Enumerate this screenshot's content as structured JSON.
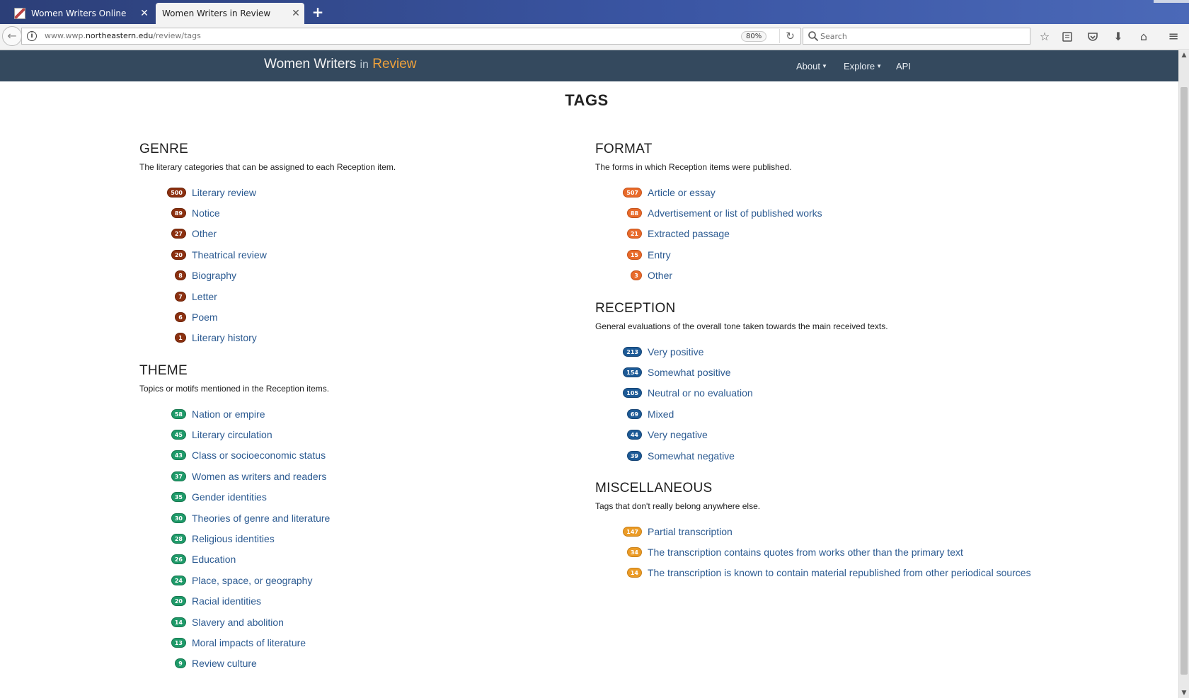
{
  "browser": {
    "tabs": [
      {
        "label": "Women Writers Online",
        "active": false
      },
      {
        "label": "Women Writers in Review",
        "active": true
      }
    ],
    "url": {
      "prefix": "www.wwp.",
      "host": "northeastern.edu",
      "path": "/review/tags"
    },
    "zoom": "80%",
    "search_placeholder": "Search"
  },
  "site": {
    "brand_main": "Women Writers",
    "brand_in": "in",
    "brand_accent": "Review",
    "nav": [
      {
        "label": "About",
        "dropdown": true
      },
      {
        "label": "Explore",
        "dropdown": true
      },
      {
        "label": "API",
        "dropdown": false
      }
    ]
  },
  "page": {
    "title": "TAGS",
    "sections": {
      "genre": {
        "heading": "GENRE",
        "description": "The literary categories that can be assigned to each Reception item.",
        "tags": [
          {
            "count": "500",
            "label": "Literary review"
          },
          {
            "count": "89",
            "label": "Notice"
          },
          {
            "count": "27",
            "label": "Other"
          },
          {
            "count": "20",
            "label": "Theatrical review"
          },
          {
            "count": "8",
            "label": "Biography"
          },
          {
            "count": "7",
            "label": "Letter"
          },
          {
            "count": "6",
            "label": "Poem"
          },
          {
            "count": "1",
            "label": "Literary history"
          }
        ]
      },
      "theme": {
        "heading": "THEME",
        "description": "Topics or motifs mentioned in the Reception items.",
        "tags": [
          {
            "count": "58",
            "label": "Nation or empire"
          },
          {
            "count": "45",
            "label": "Literary circulation"
          },
          {
            "count": "43",
            "label": "Class or socioeconomic status"
          },
          {
            "count": "37",
            "label": "Women as writers and readers"
          },
          {
            "count": "35",
            "label": "Gender identities"
          },
          {
            "count": "30",
            "label": "Theories of genre and literature"
          },
          {
            "count": "28",
            "label": "Religious identities"
          },
          {
            "count": "26",
            "label": "Education"
          },
          {
            "count": "24",
            "label": "Place, space, or geography"
          },
          {
            "count": "20",
            "label": "Racial identities"
          },
          {
            "count": "14",
            "label": "Slavery and abolition"
          },
          {
            "count": "13",
            "label": "Moral impacts of literature"
          },
          {
            "count": "9",
            "label": "Review culture"
          }
        ]
      },
      "format": {
        "heading": "FORMAT",
        "description": "The forms in which Reception items were published.",
        "tags": [
          {
            "count": "507",
            "label": "Article or essay"
          },
          {
            "count": "88",
            "label": "Advertisement or list of published works"
          },
          {
            "count": "21",
            "label": "Extracted passage"
          },
          {
            "count": "15",
            "label": "Entry"
          },
          {
            "count": "3",
            "label": "Other"
          }
        ]
      },
      "reception": {
        "heading": "RECEPTION",
        "description": "General evaluations of the overall tone taken towards the main received texts.",
        "tags": [
          {
            "count": "213",
            "label": "Very positive"
          },
          {
            "count": "154",
            "label": "Somewhat positive"
          },
          {
            "count": "105",
            "label": "Neutral or no evaluation"
          },
          {
            "count": "69",
            "label": "Mixed"
          },
          {
            "count": "44",
            "label": "Very negative"
          },
          {
            "count": "39",
            "label": "Somewhat negative"
          }
        ]
      },
      "misc": {
        "heading": "MISCELLANEOUS",
        "description": "Tags that don't really belong anywhere else.",
        "tags": [
          {
            "count": "147",
            "label": "Partial transcription"
          },
          {
            "count": "34",
            "label": "The transcription contains quotes from works other than the primary text"
          },
          {
            "count": "14",
            "label": "The transcription is known to contain material republished from other periodical sources"
          }
        ]
      }
    }
  },
  "colors": {
    "site_header": "#34495e",
    "brand_accent": "#f0a23b",
    "link": "#2b5a91",
    "genre_badge": "#8b3010",
    "theme_badge": "#1e9a69",
    "format_badge": "#e86a2a",
    "reception_badge": "#1d5a96",
    "misc_badge": "#eb9b26"
  }
}
